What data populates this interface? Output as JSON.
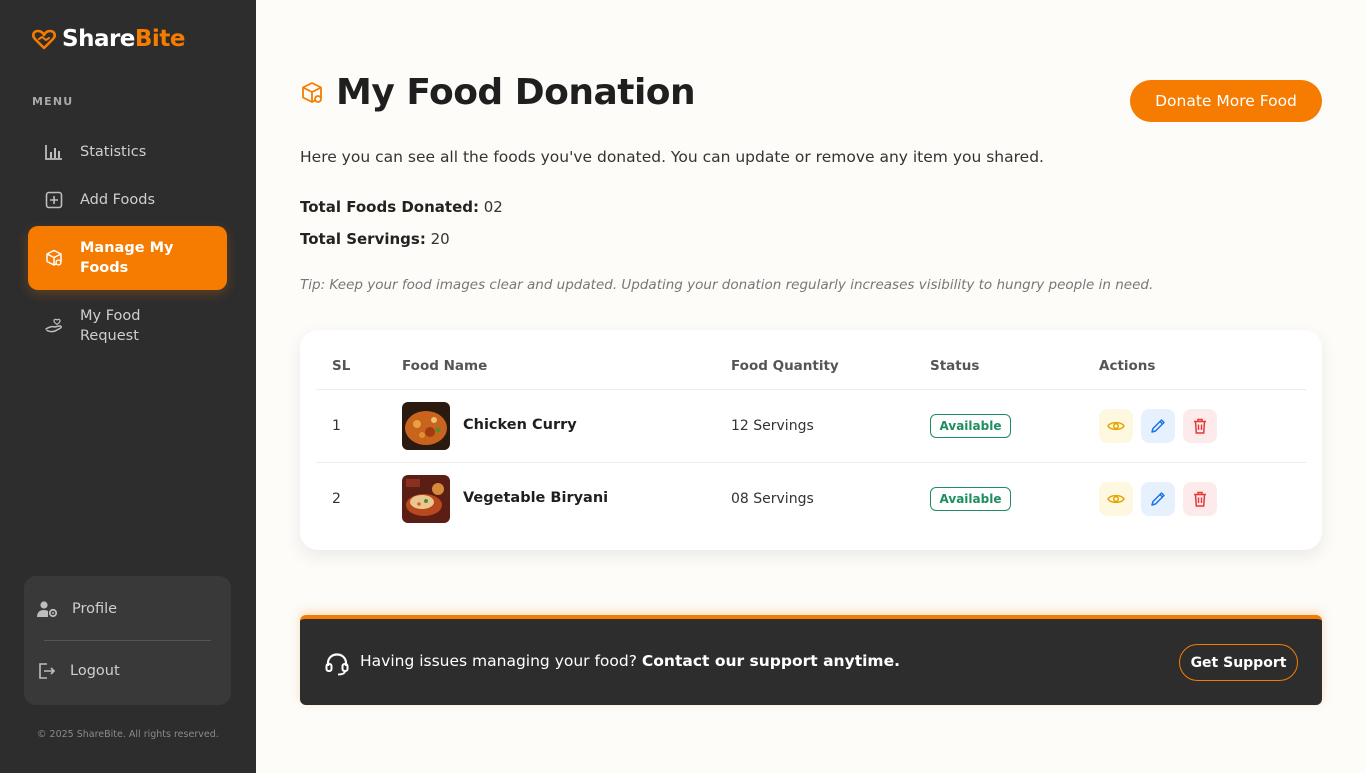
{
  "brand": {
    "part1": "Share",
    "part2": "Bite",
    "accent": "#f57c00"
  },
  "sidebar": {
    "menu_label": "MENU",
    "items": [
      {
        "label": "Statistics",
        "icon": "bar-chart-icon",
        "active": false
      },
      {
        "label": "Add Foods",
        "icon": "plus-square-icon",
        "active": false
      },
      {
        "label": "Manage My Foods",
        "icon": "box-search-icon",
        "active": true
      },
      {
        "label": "My Food Request",
        "icon": "hand-heart-icon",
        "active": false
      }
    ],
    "profile_label": "Profile",
    "logout_label": "Logout",
    "copyright": "© 2025 ShareBite. All rights reserved."
  },
  "page": {
    "title": "My Food Donation",
    "donate_button": "Donate More Food",
    "intro": "Here you can see all the foods you've donated. You can update or remove any item you shared.",
    "total_donated_label": "Total Foods Donated:",
    "total_donated_value": "02",
    "total_servings_label": "Total Servings:",
    "total_servings_value": "20",
    "tip": "Tip: Keep your food images clear and updated. Updating your donation regularly increases visibility to hungry people in need."
  },
  "table": {
    "headers": [
      "SL",
      "Food Name",
      "Food Quantity",
      "Status",
      "Actions"
    ],
    "rows": [
      {
        "sl": "1",
        "name": "Chicken Curry",
        "quantity": "12 Servings",
        "status": "Available"
      },
      {
        "sl": "2",
        "name": "Vegetable Biryani",
        "quantity": "08 Servings",
        "status": "Available"
      }
    ]
  },
  "support": {
    "text_regular": "Having issues managing your food? ",
    "text_bold": "Contact our support anytime.",
    "button": "Get Support"
  }
}
